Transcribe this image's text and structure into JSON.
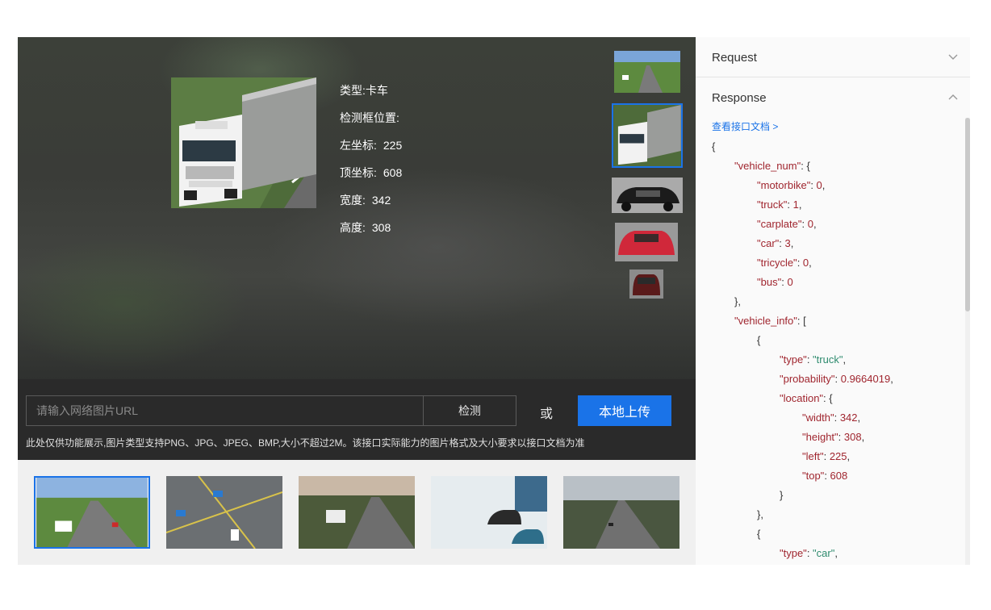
{
  "result": {
    "type_label": "类型:",
    "type_value": "卡车",
    "box_label": "检测框位置:",
    "left_label": "左坐标:",
    "left_value": "225",
    "top_label": "顶坐标:",
    "top_value": "608",
    "width_label": "宽度:",
    "width_value": "342",
    "height_label": "高度:",
    "height_value": "308"
  },
  "input": {
    "url_placeholder": "请输入网络图片URL",
    "detect_label": "检测",
    "or_label": "或",
    "upload_label": "本地上传",
    "note": "此处仅供功能展示,图片类型支持PNG、JPG、JPEG、BMP,大小不超过2M。该接口实际能力的图片格式及大小要求以接口文档为准"
  },
  "panel": {
    "request_label": "Request",
    "response_label": "Response",
    "doc_link": "查看接口文档 >"
  },
  "json": {
    "l0": "{",
    "vehicle_num_key": "\"vehicle_num\"",
    "vn_open": ": {",
    "motorbike_key": "\"motorbike\"",
    "motorbike_val": "0",
    "truck_key": "\"truck\"",
    "truck_val": "1",
    "carplate_key": "\"carplate\"",
    "carplate_val": "0",
    "car_key": "\"car\"",
    "car_val": "3",
    "tricycle_key": "\"tricycle\"",
    "tricycle_val": "0",
    "bus_key": "\"bus\"",
    "bus_val": "0",
    "vn_close": "},",
    "vehicle_info_key": "\"vehicle_info\"",
    "vi_open": ": [",
    "obj_open": "{",
    "type_key": "\"type\"",
    "type_val": "\"truck\"",
    "prob_key": "\"probability\"",
    "prob_val": "0.9664019",
    "loc_key": "\"location\"",
    "loc_open": ": {",
    "width_key": "\"width\"",
    "width_val": "342",
    "height_key": "\"height\"",
    "height_val": "308",
    "left_key": "\"left\"",
    "left_val": "225",
    "top_key": "\"top\"",
    "top_val": "608",
    "loc_close": "}",
    "obj_close": "},",
    "obj2_open": "{",
    "type2_key": "\"type\"",
    "type2_val": "\"car\""
  },
  "colors": {
    "accent": "#1a73e8",
    "json_key": "#a0262f",
    "json_string": "#2e8b6e"
  }
}
